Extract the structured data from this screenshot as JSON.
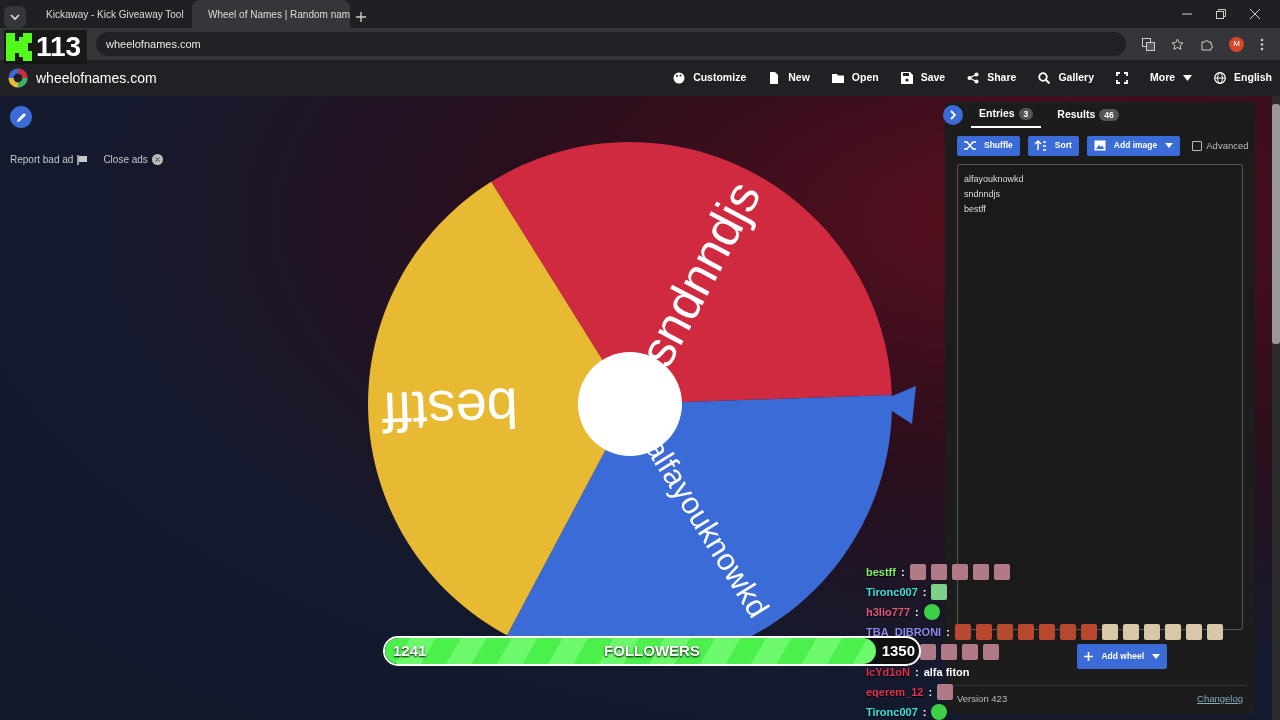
{
  "browser": {
    "tabs": [
      {
        "title": "Kickaway - Kick Giveaway Tool",
        "selected": false
      },
      {
        "title": "Wheel of Names | Random nam",
        "selected": true
      }
    ],
    "url": "wheelofnames.com",
    "profile": "M"
  },
  "app": {
    "brand": "wheelofnames.com",
    "menu": [
      {
        "kind": "link",
        "label": "Customize"
      },
      {
        "kind": "link",
        "label": "New"
      },
      {
        "kind": "link",
        "label": "Open"
      },
      {
        "kind": "link",
        "label": "Save"
      },
      {
        "kind": "link",
        "label": "Share"
      },
      {
        "kind": "link",
        "label": "Gallery"
      },
      {
        "kind": "icon"
      },
      {
        "kind": "dropdown",
        "label": "More"
      },
      {
        "kind": "link",
        "label": "English"
      }
    ]
  },
  "ads": {
    "report": "Report bad ad",
    "close": "Close ads"
  },
  "wheel": {
    "slices": [
      {
        "label": "sndnndjs",
        "color": "#d02a40"
      },
      {
        "label": "alfayouknowkd",
        "color": "#3b6bd6"
      },
      {
        "label": "bestff",
        "color": "#e8b932"
      }
    ]
  },
  "panel": {
    "tabs": [
      {
        "label": "Entries",
        "count": "3",
        "selected": true
      },
      {
        "label": "Results",
        "count": "46",
        "selected": false
      }
    ],
    "buttons": [
      {
        "kind": "plain",
        "label": "Shuffle"
      },
      {
        "kind": "plain",
        "label": "Sort"
      },
      {
        "kind": "dropdown",
        "label": "Add image"
      }
    ],
    "advanced": {
      "label": "Advanced",
      "checked": false
    },
    "entries": [
      "alfayouknowkd",
      "sndnndjs",
      "bestff"
    ],
    "add_wheel": "Add wheel",
    "version": "Version 423",
    "changelog": "Changelog"
  },
  "stream_overlay": {
    "counter": "113",
    "followers": {
      "current": "1241",
      "label": "FOLLOWERS",
      "goal": "1350",
      "level": 0.92
    },
    "chat": [
      {
        "user": "bestff",
        "color": "#7cf06a",
        "separator": ":"
      },
      {
        "user": "Tironc007",
        "color": "#3ee0d8",
        "separator": ":"
      },
      {
        "user": "h3lio777",
        "color": "#e05a78",
        "separator": ":"
      },
      {
        "user": "TBA_DIBRONI",
        "color": "#8c8cf0",
        "separator": ":"
      },
      {
        "user": "lcYd1oN",
        "color": "#e0304a",
        "separator": ":",
        "text": "alfa fiton"
      },
      {
        "user": "eqerem_12",
        "color": "#e0304a",
        "separator": ":"
      },
      {
        "user": "Tironc007",
        "color": "#3ee0d8",
        "separator": ":"
      }
    ]
  }
}
